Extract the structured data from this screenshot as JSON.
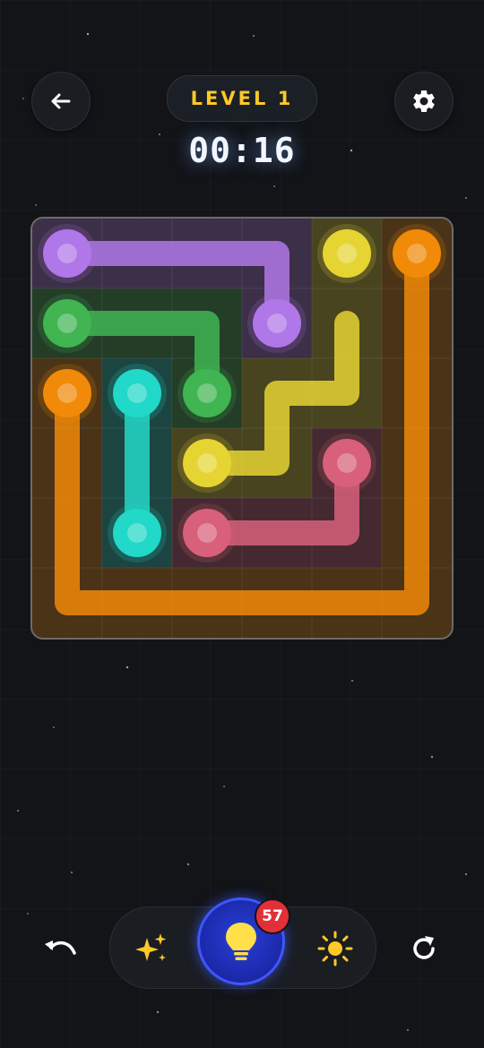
{
  "header": {
    "level_label": "LEVEL 1",
    "timer": "00:16"
  },
  "colors": {
    "purple": "#b077e8",
    "yellow": "#e6d432",
    "orange": "#f08a08",
    "green": "#40b552",
    "cyan": "#22d8c8",
    "pink": "#d8607a"
  },
  "board": {
    "rows": 6,
    "cols": 6,
    "flows": [
      {
        "color": "purple",
        "cells": [
          [
            0,
            0
          ],
          [
            0,
            1
          ],
          [
            0,
            2
          ],
          [
            0,
            3
          ],
          [
            1,
            3
          ]
        ],
        "complete": true
      },
      {
        "color": "green",
        "cells": [
          [
            1,
            0
          ],
          [
            1,
            1
          ],
          [
            1,
            2
          ],
          [
            2,
            2
          ]
        ],
        "complete": true
      },
      {
        "color": "yellow",
        "cells": [
          [
            3,
            2
          ],
          [
            3,
            3
          ],
          [
            2,
            3
          ],
          [
            2,
            4
          ],
          [
            1,
            4
          ]
        ],
        "complete": false,
        "endpoints": [
          [
            0,
            4
          ],
          [
            3,
            2
          ]
        ]
      },
      {
        "color": "orange",
        "cells": [
          [
            2,
            0
          ],
          [
            3,
            0
          ],
          [
            4,
            0
          ],
          [
            5,
            0
          ],
          [
            5,
            1
          ],
          [
            5,
            2
          ],
          [
            5,
            3
          ],
          [
            5,
            4
          ],
          [
            5,
            5
          ],
          [
            4,
            5
          ],
          [
            3,
            5
          ],
          [
            2,
            5
          ],
          [
            1,
            5
          ],
          [
            0,
            5
          ]
        ],
        "complete": true
      },
      {
        "color": "cyan",
        "cells": [
          [
            2,
            1
          ],
          [
            3,
            1
          ],
          [
            4,
            1
          ]
        ],
        "complete": true
      },
      {
        "color": "pink",
        "cells": [
          [
            4,
            2
          ],
          [
            4,
            3
          ],
          [
            4,
            4
          ],
          [
            3,
            4
          ]
        ],
        "complete": true
      }
    ]
  },
  "toolbar": {
    "hint_count": "57",
    "icons": [
      "undo-icon",
      "sparkle-icon",
      "lightbulb-icon",
      "sun-icon",
      "restart-icon"
    ]
  }
}
